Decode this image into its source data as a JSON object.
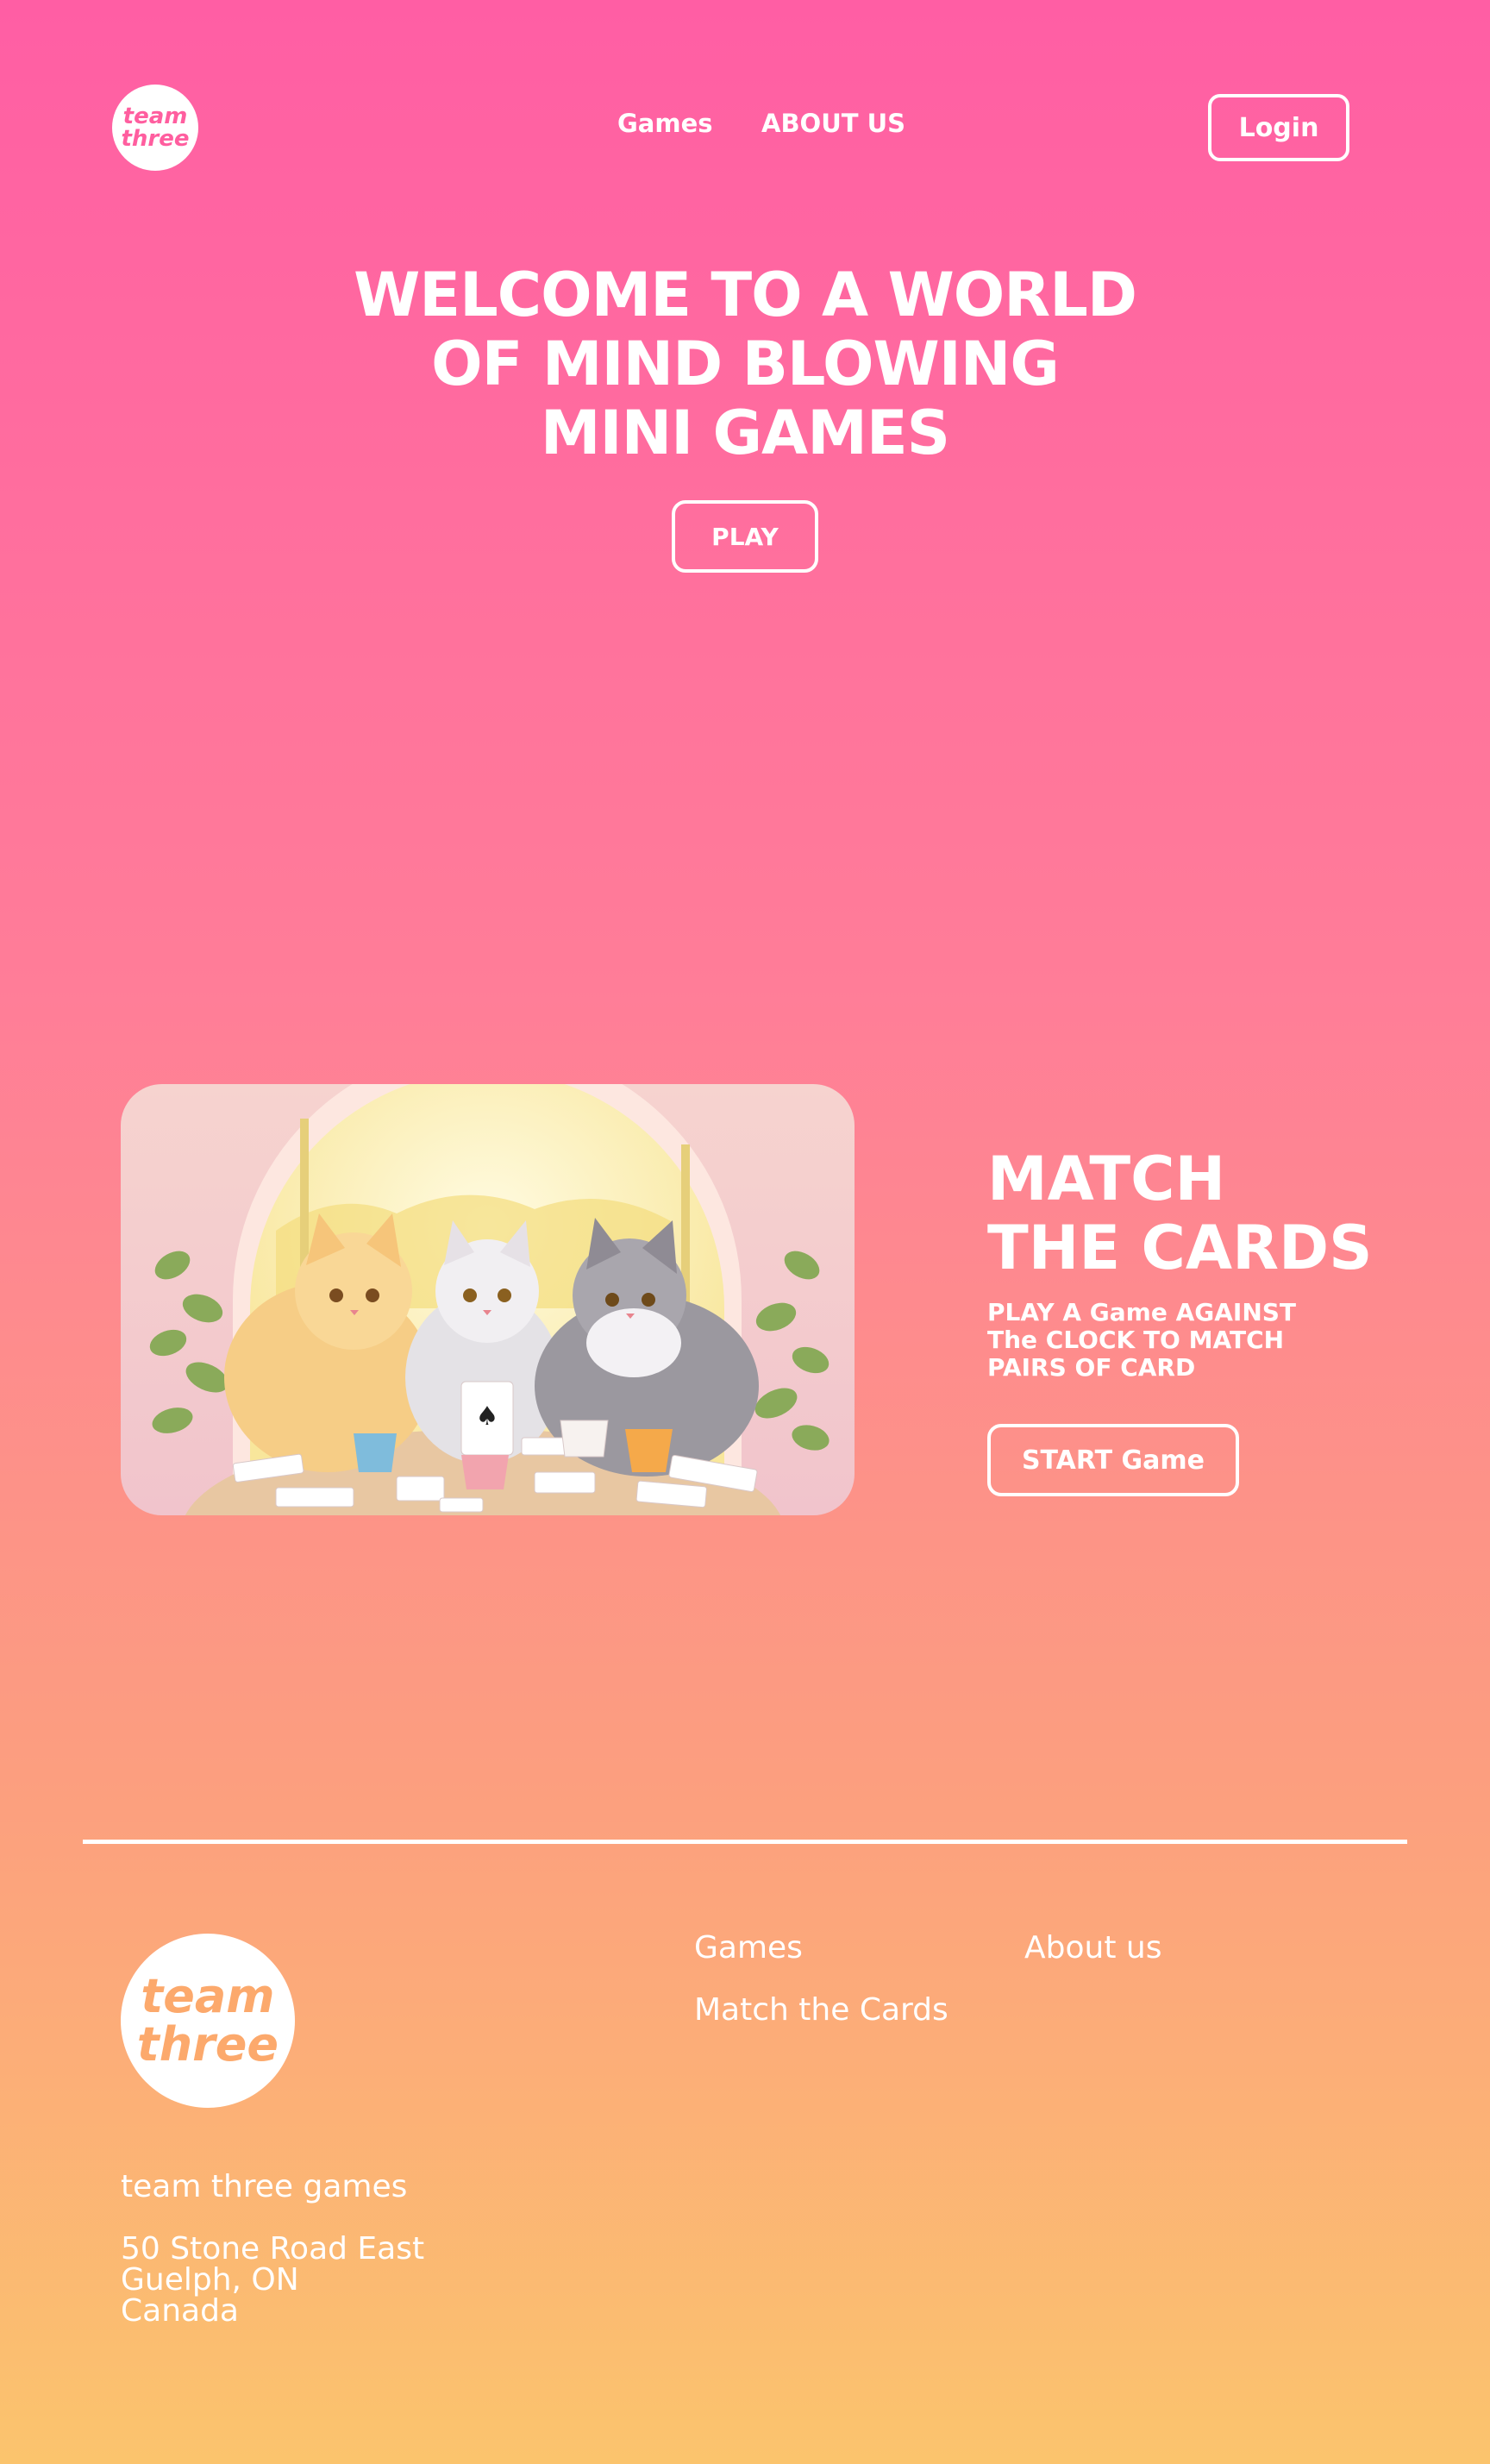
{
  "header": {
    "logo": {
      "line1": "team",
      "line2": "three"
    },
    "nav": [
      {
        "label": "Games"
      },
      {
        "label": "ABOUT US"
      }
    ],
    "login_label": "Login"
  },
  "hero": {
    "title_lines": [
      "WELCOME TO A WORLD",
      "OF MIND BLOWING",
      "MINI GAMES"
    ],
    "play_label": "PLAY"
  },
  "game": {
    "image_icon": "cats-playing-cards-illustration",
    "title_lines": [
      "MATCH",
      "THE CARDS"
    ],
    "description_lines": [
      "PLAY A Game AGAINST",
      "The CLOCK TO MATCH",
      "PAIRS OF CARD"
    ],
    "start_label": "START Game"
  },
  "footer": {
    "logo": {
      "line1": "team",
      "line2": "three"
    },
    "links": {
      "games": "Games",
      "about": "About us",
      "match": "Match the Cards"
    },
    "company": "team three games",
    "address": [
      "50 Stone Road East",
      "Guelph, ON",
      "Canada"
    ]
  },
  "colors": {
    "gradient_top": "#ff5ea4",
    "gradient_mid": "#ff7d98",
    "gradient_bottom": "#fbc46d",
    "text": "#ffffff",
    "logo_pink": "#ff5e9f",
    "logo_orange": "#fca96c"
  }
}
